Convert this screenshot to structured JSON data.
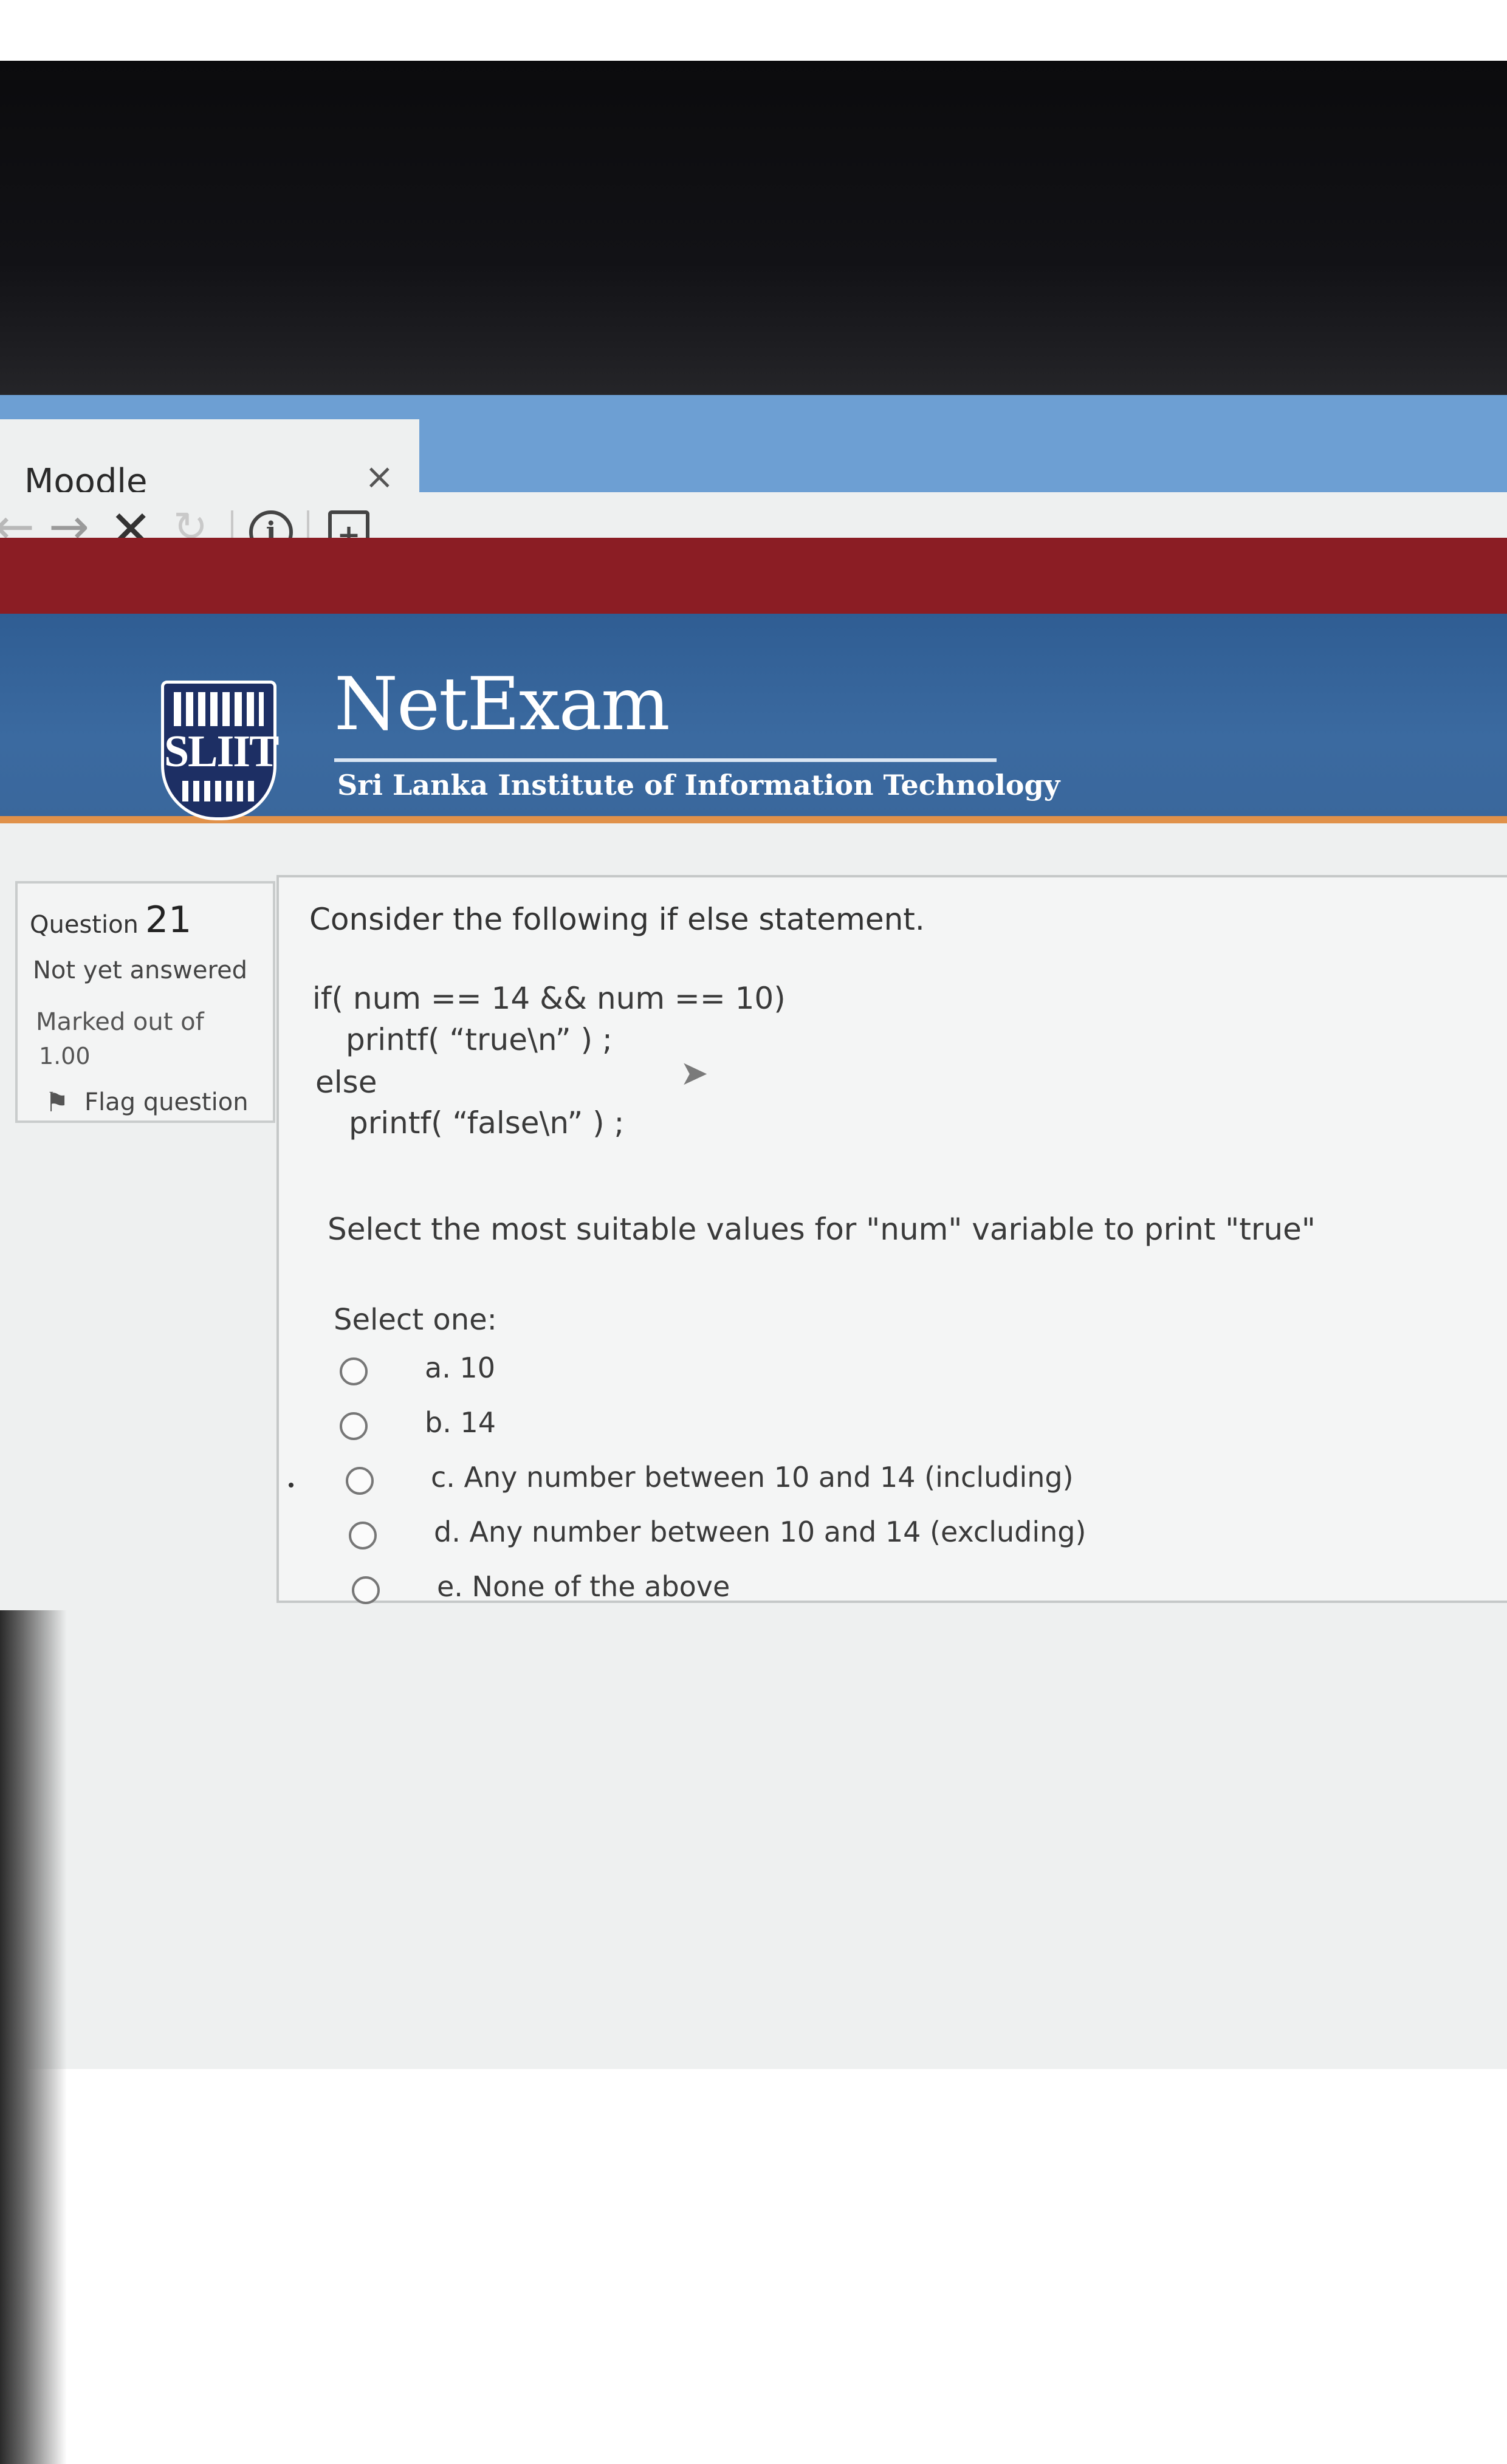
{
  "browser": {
    "tab_title": "Moodle",
    "tab_close": "×",
    "nav": {
      "back": "←",
      "forward": "→",
      "stop": "✕",
      "reload": "↻",
      "info": "i",
      "page": "+"
    }
  },
  "header": {
    "logo_text": "SLIIT",
    "brand_title": "NetExam",
    "brand_subtitle": "Sri Lanka Institute of Information Technology"
  },
  "question_info": {
    "label": "Question",
    "number": "21",
    "state": "Not yet answered",
    "marked_label": "Marked out of",
    "marked_value": "1.00",
    "flag_label": "Flag question"
  },
  "question": {
    "intro": "Consider the following if else statement.",
    "code": [
      "if( num == 14 && num == 10)",
      "printf( “true\\n” ) ;",
      "else",
      "printf( “false\\n” ) ;"
    ],
    "prompt": "Select the most suitable  values for \"num\" variable to print \"true\"",
    "select_label": "Select one:",
    "options": [
      "a. 10",
      "b. 14",
      "c. Any number between 10 and 14 (including)",
      "d. Any number between 10 and 14 (excluding)",
      "e. None of the above"
    ]
  }
}
